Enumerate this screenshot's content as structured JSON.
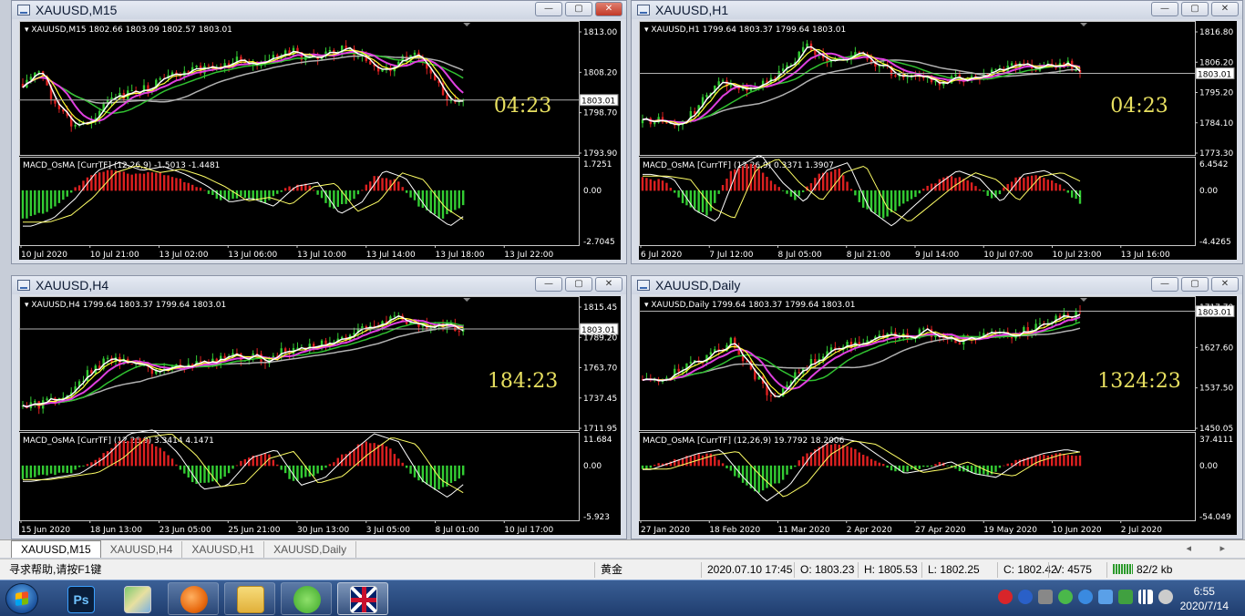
{
  "windows": [
    {
      "id": "m15",
      "title": "XAUUSD,M15",
      "info": "XAUUSD,M15  1802.66 1803.09 1802.57 1803.01",
      "macd_info": "MACD_OsMA [CurrTF] (12,26,9) -1.5013 -1.4481",
      "countdown": "04:23",
      "price_label": "1803.01",
      "price_ticks": [
        "1813.00",
        "1808.20",
        "1798.70",
        "1793.90"
      ],
      "macd_ticks": [
        "1.7251",
        "0.00",
        "-2.7045"
      ],
      "time_ticks": [
        "10 Jul 2020",
        "10 Jul 21:00",
        "13 Jul 02:00",
        "13 Jul 06:00",
        "13 Jul 10:00",
        "13 Jul 14:00",
        "13 Jul 18:00",
        "13 Jul 22:00"
      ]
    },
    {
      "id": "h1",
      "title": "XAUUSD,H1",
      "info": "XAUUSD,H1  1799.64 1803.37 1799.64 1803.01",
      "macd_info": "MACD_OsMA [CurrTF] (12,26,9) 0.3371 1.3907",
      "countdown": "04:23",
      "price_label": "1803.01",
      "price_ticks": [
        "1816.80",
        "1806.20",
        "1795.20",
        "1784.10",
        "1773.30"
      ],
      "macd_ticks": [
        "6.4542",
        "0.00",
        "-4.4265"
      ],
      "time_ticks": [
        "6 Jul 2020",
        "7 Jul 12:00",
        "8 Jul 05:00",
        "8 Jul 21:00",
        "9 Jul 14:00",
        "10 Jul 07:00",
        "10 Jul 23:00",
        "13 Jul 16:00"
      ]
    },
    {
      "id": "h4",
      "title": "XAUUSD,H4",
      "info": "XAUUSD,H4  1799.64 1803.37 1799.64 1803.01",
      "macd_info": "MACD_OsMA [CurrTF] (12,26,9) 3.3414 4.1471",
      "countdown": "184:23",
      "price_label": "1803.01",
      "price_ticks": [
        "1815.45",
        "1789.20",
        "1763.70",
        "1737.45",
        "1711.95"
      ],
      "macd_ticks": [
        "11.684",
        "0.00",
        "-5.923"
      ],
      "time_ticks": [
        "15 Jun 2020",
        "18 Jun 13:00",
        "23 Jun 05:00",
        "25 Jun 21:00",
        "30 Jun 13:00",
        "3 Jul 05:00",
        "8 Jul 01:00",
        "10 Jul 17:00"
      ]
    },
    {
      "id": "daily",
      "title": "XAUUSD,Daily",
      "info": "XAUUSD,Daily  1799.64 1803.37 1799.64 1803.01",
      "macd_info": "MACD_OsMA [CurrTF] (12,26,9) 19.7792 18.2006",
      "countdown": "1324:23",
      "price_label": "1803.01",
      "price_ticks": [
        "1717.70",
        "1627.60",
        "1537.50",
        "1450.05"
      ],
      "macd_ticks": [
        "37.4111",
        "0.00",
        "-54.049"
      ],
      "time_ticks": [
        "27 Jan 2020",
        "18 Feb 2020",
        "11 Mar 2020",
        "2 Apr 2020",
        "27 Apr 2020",
        "19 May 2020",
        "10 Jun 2020",
        "2 Jul 2020"
      ]
    }
  ],
  "tabs": [
    "XAUUSD,M15",
    "XAUUSD,H4",
    "XAUUSD,H1",
    "XAUUSD,Daily"
  ],
  "tab_scroll": "◂ ▸",
  "status": {
    "help": "寻求帮助,请按F1键",
    "symbol_name": "黄金",
    "datetime": "2020.07.10 17:45",
    "open": "O: 1803.23",
    "high": "H: 1805.53",
    "low": "L: 1802.25",
    "close": "C: 1802.42",
    "volume": "V: 4575",
    "traffic": "82/2 kb"
  },
  "taskbar": {
    "ps_label": "Ps",
    "time": "6:55",
    "date": "2020/7/14"
  },
  "window_buttons": {
    "minimize": "—",
    "maximize": "▢",
    "close": "✕"
  },
  "colors": {
    "candle_up": "#33cc33",
    "candle_down": "#dd2020",
    "ma_fast": "#ffffff",
    "ma_yellow": "#ffff33",
    "ma_magenta": "#e040e0",
    "ma_green": "#30c030",
    "ma_gray": "#b0b0b0",
    "countdown": "#e8e060"
  }
}
